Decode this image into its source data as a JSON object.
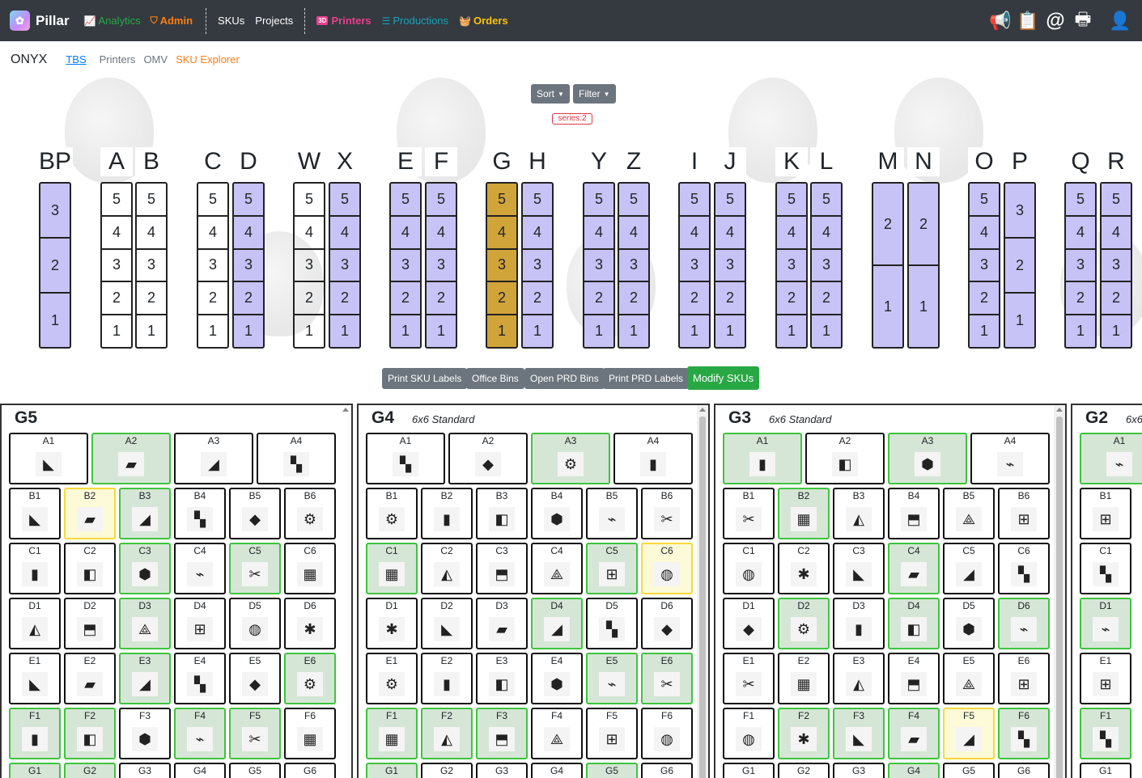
{
  "app": {
    "name": "Pillar"
  },
  "nav": {
    "analytics": "Analytics",
    "admin": "Admin",
    "skus": "SKUs",
    "projects": "Projects",
    "printers": "Printers",
    "productions": "Productions",
    "orders": "Orders",
    "printers_badge": "3D"
  },
  "colors": {
    "analytics": "#28a745",
    "admin": "#fd7e14",
    "printers": "#e83e8c",
    "productions": "#17a2b8",
    "orders": "#ffc107",
    "bin_green": "#3ec43e",
    "bin_yellow": "#f7d93a",
    "slot_lavender": "#c3bef5",
    "slot_gold": "#d1a43a"
  },
  "subnav": {
    "title": "ONYX",
    "tbs": "TBS",
    "printers": "Printers",
    "omv": "OMV",
    "sku_explorer": "SKU Explorer"
  },
  "controls": {
    "sort": "Sort",
    "filter": "Filter",
    "badge": "series:2"
  },
  "columns": [
    {
      "letter": "BP",
      "slots": [
        "3",
        "2",
        "1"
      ],
      "fill": "lavender"
    },
    {
      "letter": "A",
      "slots": [
        "5",
        "4",
        "3",
        "2",
        "1"
      ],
      "fill": "white"
    },
    {
      "letter": "B",
      "slots": [
        "5",
        "4",
        "3",
        "2",
        "1"
      ],
      "fill": "white"
    },
    {
      "letter": "C",
      "slots": [
        "5",
        "4",
        "3",
        "2",
        "1"
      ],
      "fill": "white"
    },
    {
      "letter": "D",
      "slots": [
        "5",
        "4",
        "3",
        "2",
        "1"
      ],
      "fill": "lavender"
    },
    {
      "letter": "W",
      "slots": [
        "5",
        "4",
        "3",
        "2",
        "1"
      ],
      "fill": "white"
    },
    {
      "letter": "X",
      "slots": [
        "5",
        "4",
        "3",
        "2",
        "1"
      ],
      "fill": "lavender"
    },
    {
      "letter": "E",
      "slots": [
        "5",
        "4",
        "3",
        "2",
        "1"
      ],
      "fill": "lavender"
    },
    {
      "letter": "F",
      "slots": [
        "5",
        "4",
        "3",
        "2",
        "1"
      ],
      "fill": "lavender"
    },
    {
      "letter": "G",
      "slots": [
        "5",
        "4",
        "3",
        "2",
        "1"
      ],
      "fill": "gold"
    },
    {
      "letter": "H",
      "slots": [
        "5",
        "4",
        "3",
        "2",
        "1"
      ],
      "fill": "lavender"
    },
    {
      "letter": "Y",
      "slots": [
        "5",
        "4",
        "3",
        "2",
        "1"
      ],
      "fill": "lavender"
    },
    {
      "letter": "Z",
      "slots": [
        "5",
        "4",
        "3",
        "2",
        "1"
      ],
      "fill": "lavender"
    },
    {
      "letter": "I",
      "slots": [
        "5",
        "4",
        "3",
        "2",
        "1"
      ],
      "fill": "lavender"
    },
    {
      "letter": "J",
      "slots": [
        "5",
        "4",
        "3",
        "2",
        "1"
      ],
      "fill": "lavender"
    },
    {
      "letter": "K",
      "slots": [
        "5",
        "4",
        "3",
        "2",
        "1"
      ],
      "fill": "lavender"
    },
    {
      "letter": "L",
      "slots": [
        "5",
        "4",
        "3",
        "2",
        "1"
      ],
      "fill": "lavender"
    },
    {
      "letter": "M",
      "slots": [
        "2",
        "1"
      ],
      "fill": "lavender"
    },
    {
      "letter": "N",
      "slots": [
        "2",
        "1"
      ],
      "fill": "lavender"
    },
    {
      "letter": "O",
      "slots": [
        "5",
        "4",
        "3",
        "2",
        "1"
      ],
      "fill": "lavender"
    },
    {
      "letter": "P",
      "slots": [
        "3",
        "2",
        "1"
      ],
      "fill": "lavender"
    },
    {
      "letter": "Q",
      "slots": [
        "5",
        "4",
        "3",
        "2",
        "1"
      ],
      "fill": "lavender"
    },
    {
      "letter": "R",
      "slots": [
        "5",
        "4",
        "3",
        "2",
        "1"
      ],
      "fill": "lavender"
    }
  ],
  "actions": {
    "print_sku_labels": "Print SKU Labels",
    "office_bins": "Office Bins",
    "open_prd_bins": "Open PRD Bins",
    "print_prd_labels": "Print PRD Labels",
    "modify_skus": "Modify SKUs"
  },
  "panels": [
    {
      "title": "G5",
      "subtitle": "",
      "rowA": [
        [
          "A1",
          ""
        ],
        [
          "A2",
          "g"
        ],
        [
          "A3",
          ""
        ],
        [
          "A4",
          ""
        ]
      ],
      "rows": [
        [
          [
            "B1",
            ""
          ],
          [
            "B2",
            "y"
          ],
          [
            "B3",
            "g"
          ],
          [
            "B4",
            ""
          ],
          [
            "B5",
            ""
          ],
          [
            "B6",
            ""
          ]
        ],
        [
          [
            "C1",
            ""
          ],
          [
            "C2",
            ""
          ],
          [
            "C3",
            "g"
          ],
          [
            "C4",
            ""
          ],
          [
            "C5",
            "g"
          ],
          [
            "C6",
            ""
          ]
        ],
        [
          [
            "D1",
            ""
          ],
          [
            "D2",
            ""
          ],
          [
            "D3",
            "g"
          ],
          [
            "D4",
            ""
          ],
          [
            "D5",
            ""
          ],
          [
            "D6",
            ""
          ]
        ],
        [
          [
            "E1",
            ""
          ],
          [
            "E2",
            ""
          ],
          [
            "E3",
            "g"
          ],
          [
            "E4",
            ""
          ],
          [
            "E5",
            ""
          ],
          [
            "E6",
            "g"
          ]
        ],
        [
          [
            "F1",
            "g"
          ],
          [
            "F2",
            "g"
          ],
          [
            "F3",
            ""
          ],
          [
            "F4",
            "g"
          ],
          [
            "F5",
            "g"
          ],
          [
            "F6",
            ""
          ]
        ],
        [
          [
            "G1",
            "g"
          ],
          [
            "G2",
            "g"
          ],
          [
            "G3",
            ""
          ],
          [
            "G4",
            ""
          ],
          [
            "G5",
            ""
          ],
          [
            "G6",
            ""
          ]
        ]
      ]
    },
    {
      "title": "G4",
      "subtitle": "6x6 Standard",
      "rowA": [
        [
          "A1",
          ""
        ],
        [
          "A2",
          ""
        ],
        [
          "A3",
          "g"
        ],
        [
          "A4",
          ""
        ]
      ],
      "rows": [
        [
          [
            "B1",
            ""
          ],
          [
            "B2",
            ""
          ],
          [
            "B3",
            ""
          ],
          [
            "B4",
            ""
          ],
          [
            "B5",
            ""
          ],
          [
            "B6",
            ""
          ]
        ],
        [
          [
            "C1",
            "g"
          ],
          [
            "C2",
            ""
          ],
          [
            "C3",
            ""
          ],
          [
            "C4",
            ""
          ],
          [
            "C5",
            "g"
          ],
          [
            "C6",
            "y"
          ]
        ],
        [
          [
            "D1",
            ""
          ],
          [
            "D2",
            ""
          ],
          [
            "D3",
            ""
          ],
          [
            "D4",
            "g"
          ],
          [
            "D5",
            ""
          ],
          [
            "D6",
            ""
          ]
        ],
        [
          [
            "E1",
            ""
          ],
          [
            "E2",
            ""
          ],
          [
            "E3",
            ""
          ],
          [
            "E4",
            ""
          ],
          [
            "E5",
            "g"
          ],
          [
            "E6",
            "g"
          ]
        ],
        [
          [
            "F1",
            "g"
          ],
          [
            "F2",
            "g"
          ],
          [
            "F3",
            "g"
          ],
          [
            "F4",
            ""
          ],
          [
            "F5",
            ""
          ],
          [
            "F6",
            ""
          ]
        ],
        [
          [
            "G1",
            "g"
          ],
          [
            "G2",
            ""
          ],
          [
            "G3",
            ""
          ],
          [
            "G4",
            ""
          ],
          [
            "G5",
            "g"
          ],
          [
            "G6",
            ""
          ]
        ]
      ]
    },
    {
      "title": "G3",
      "subtitle": "6x6 Standard",
      "rowA": [
        [
          "A1",
          "g"
        ],
        [
          "A2",
          ""
        ],
        [
          "A3",
          "g"
        ],
        [
          "A4",
          ""
        ]
      ],
      "rows": [
        [
          [
            "B1",
            ""
          ],
          [
            "B2",
            "g"
          ],
          [
            "B3",
            ""
          ],
          [
            "B4",
            ""
          ],
          [
            "B5",
            ""
          ],
          [
            "B6",
            ""
          ]
        ],
        [
          [
            "C1",
            ""
          ],
          [
            "C2",
            ""
          ],
          [
            "C3",
            ""
          ],
          [
            "C4",
            "g"
          ],
          [
            "C5",
            ""
          ],
          [
            "C6",
            ""
          ]
        ],
        [
          [
            "D1",
            ""
          ],
          [
            "D2",
            "g"
          ],
          [
            "D3",
            ""
          ],
          [
            "D4",
            "g"
          ],
          [
            "D5",
            ""
          ],
          [
            "D6",
            "g"
          ]
        ],
        [
          [
            "E1",
            ""
          ],
          [
            "E2",
            ""
          ],
          [
            "E3",
            ""
          ],
          [
            "E4",
            ""
          ],
          [
            "E5",
            ""
          ],
          [
            "E6",
            ""
          ]
        ],
        [
          [
            "F1",
            ""
          ],
          [
            "F2",
            "g"
          ],
          [
            "F3",
            "g"
          ],
          [
            "F4",
            "g"
          ],
          [
            "F5",
            "y"
          ],
          [
            "F6",
            "g"
          ]
        ],
        [
          [
            "G1",
            ""
          ],
          [
            "G2",
            ""
          ],
          [
            "G3",
            ""
          ],
          [
            "G4",
            "g"
          ],
          [
            "G5",
            ""
          ],
          [
            "G6",
            ""
          ]
        ]
      ]
    },
    {
      "title": "G2",
      "subtitle": "6x6",
      "rowA": [
        [
          "A1",
          "g"
        ]
      ],
      "rows": [
        [
          [
            "B1",
            ""
          ]
        ],
        [
          [
            "C1",
            ""
          ]
        ],
        [
          [
            "D1",
            "g"
          ]
        ],
        [
          [
            "E1",
            ""
          ]
        ],
        [
          [
            "F1",
            "g"
          ]
        ],
        [
          [
            "G1",
            ""
          ]
        ]
      ]
    }
  ]
}
